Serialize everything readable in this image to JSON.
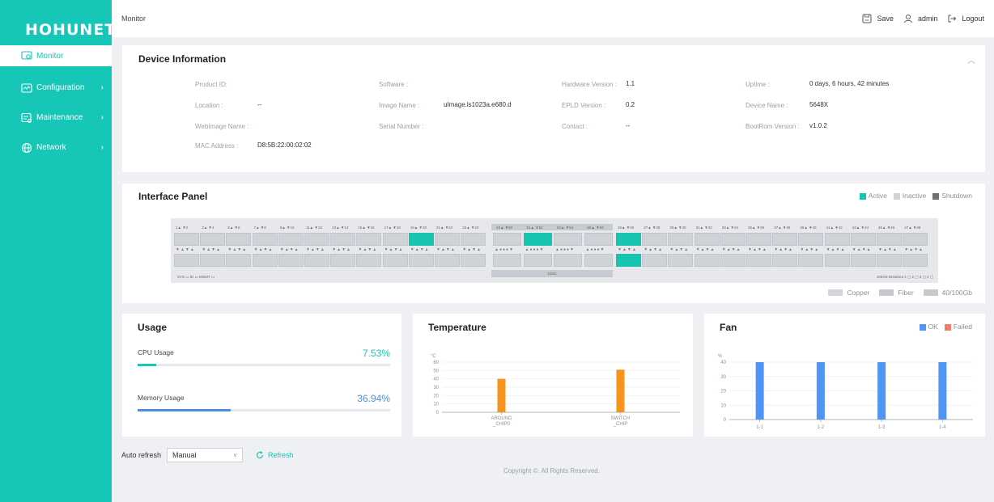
{
  "brand": "HOHUNET",
  "nav": [
    {
      "label": "Monitor",
      "icon": "monitor-icon",
      "active": true
    },
    {
      "label": "Configuration",
      "icon": "config-icon",
      "active": false
    },
    {
      "label": "Maintenance",
      "icon": "maintenance-icon",
      "active": false
    },
    {
      "label": "Network",
      "icon": "globe-icon",
      "active": false
    }
  ],
  "header": {
    "breadcrumb": "Monitor",
    "save": "Save",
    "user": "admin",
    "logout": "Logout"
  },
  "device_info": {
    "title": "Device Information",
    "fields": [
      {
        "label": "Product ID:",
        "value": ""
      },
      {
        "label": "Software :",
        "value": ""
      },
      {
        "label": "Hardware Version :",
        "value": "1.1"
      },
      {
        "label": "Uptime :",
        "value": "0 days, 6 hours, 42 minutes"
      },
      {
        "label": "Location :",
        "value": "--"
      },
      {
        "label": "Image Name :",
        "value": "uImage.ls1023a.e680.d"
      },
      {
        "label": "EPLD Version :",
        "value": "0.2"
      },
      {
        "label": "Device Name :",
        "value": "5648X"
      },
      {
        "label": "WebImage Name :",
        "value": ""
      },
      {
        "label": "Serial Number :",
        "value": ""
      },
      {
        "label": "Contact :",
        "value": "--"
      },
      {
        "label": "BootRom Version :",
        "value": "v1.0.2"
      },
      {
        "label": "MAC Address :",
        "value": "D8:5B:22:00:02:02"
      }
    ]
  },
  "interface_panel": {
    "title": "Interface Panel",
    "legend": [
      {
        "label": "Active",
        "color": "#17c4b0"
      },
      {
        "label": "Inactive",
        "color": "#cfd3d8"
      },
      {
        "label": "Shutdown",
        "color": "#6b7077"
      }
    ],
    "left_labels": [
      "1▲ ▼2",
      "3▲ ▼4",
      "5▲ ▼6",
      "7▲ ▼8",
      "9▲ ▼10",
      "11▲ ▼12",
      "13▲ ▼14",
      "15▲ ▼16",
      "17▲ ▼18",
      "19▲ ▼20",
      "21▲ ▼22",
      "23▲ ▼24"
    ],
    "mid_labels": [
      "49▲ ▼50",
      "51▲ ▼52",
      "53▲ ▼54",
      "55▲ ▼56"
    ],
    "right_labels": [
      "25▲ ▼26",
      "27▲ ▼28",
      "29▲ ▼30",
      "31▲ ▼32",
      "33▲ ▼34",
      "35▲ ▼36",
      "37▲ ▼38",
      "39▲ ▼40",
      "41▲ ▼42",
      "43▲ ▼44",
      "45▲ ▼46",
      "47▲ ▼48"
    ],
    "active_top": [
      9,
      13,
      16
    ],
    "active_bottom": [
      16
    ],
    "bottom_left": "SYS ▭   ID ▭   MGMT ▭",
    "mid_bar": "100G",
    "breakout": "100GE Breakout   1 ▢  2 ▢  3 ▢  4 ▢",
    "media_legend": [
      {
        "label": "Copper"
      },
      {
        "label": "Fiber"
      },
      {
        "label": "40/100Gb"
      }
    ]
  },
  "usage": {
    "title": "Usage",
    "cpu_label": "CPU Usage",
    "cpu_value": "7.53%",
    "cpu_pct": 7.53,
    "cpu_color": "#16c6b6",
    "mem_label": "Memory Usage",
    "mem_value": "36.94%",
    "mem_pct": 36.94,
    "mem_color": "#4a90e2"
  },
  "temperature": {
    "title": "Temperature",
    "chart_data": {
      "type": "bar",
      "ylabel": "°C",
      "ylim": [
        0,
        60
      ],
      "yticks": [
        0,
        10,
        20,
        30,
        40,
        50,
        60
      ],
      "categories": [
        "AROUND\n_CHIP0",
        "SWITCH\n_CHIP"
      ],
      "category_lines": [
        [
          "AROUND",
          "_CHIP0"
        ],
        [
          "SWITCH",
          "_CHIP"
        ]
      ],
      "values": [
        40,
        51
      ],
      "color": "#f7941d"
    }
  },
  "fan": {
    "title": "Fan",
    "legend": [
      {
        "label": "OK",
        "color": "#4e95f4"
      },
      {
        "label": "Failed",
        "color": "#f47c6a"
      }
    ],
    "chart_data": {
      "type": "bar",
      "ylabel": "%",
      "ylim": [
        0,
        40
      ],
      "yticks": [
        0,
        10,
        20,
        30,
        40
      ],
      "categories": [
        "1-1",
        "1-2",
        "1-3",
        "1-4"
      ],
      "values": [
        40,
        40,
        40,
        40
      ],
      "color": "#4e95f4"
    }
  },
  "footer": {
    "auto_refresh": "Auto refresh",
    "mode": "Manual",
    "refresh": "Refresh",
    "copyright": "Copyright ©. All Rights Reserved."
  }
}
